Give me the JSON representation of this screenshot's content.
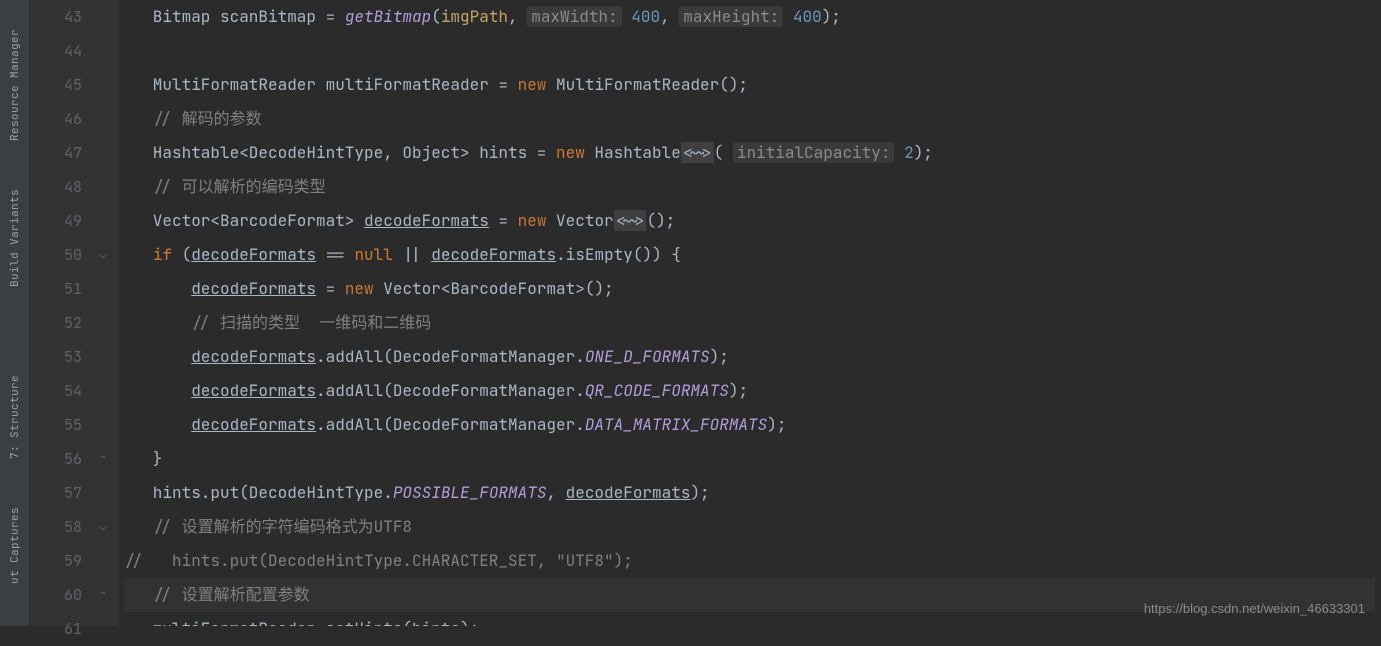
{
  "sidebar": {
    "items": [
      {
        "label": "Resource Manager"
      },
      {
        "label": "Build Variants"
      },
      {
        "label": "7: Structure"
      },
      {
        "label": "ut Captures"
      }
    ]
  },
  "gutter": {
    "start": 43,
    "end": 61
  },
  "code": {
    "lines": [
      {
        "n": 43,
        "segs": [
          {
            "t": "   Bitmap scanBitmap = ",
            "c": "type"
          },
          {
            "t": "getBitmap",
            "c": "meth"
          },
          {
            "t": "(",
            "c": "type"
          },
          {
            "t": "imgPath",
            "c": "param"
          },
          {
            "t": ", ",
            "c": "type"
          },
          {
            "t": "maxWidth:",
            "c": "paramhint"
          },
          {
            "t": " ",
            "c": "type"
          },
          {
            "t": "400",
            "c": "num"
          },
          {
            "t": ", ",
            "c": "type"
          },
          {
            "t": "maxHeight:",
            "c": "paramhint"
          },
          {
            "t": " ",
            "c": "type"
          },
          {
            "t": "400",
            "c": "num"
          },
          {
            "t": ");",
            "c": "type"
          }
        ]
      },
      {
        "n": 44,
        "segs": [
          {
            "t": "",
            "c": "type"
          }
        ]
      },
      {
        "n": 45,
        "segs": [
          {
            "t": "   MultiFormatReader multiFormatReader = ",
            "c": "type"
          },
          {
            "t": "new",
            "c": "kw"
          },
          {
            "t": " MultiFormatReader();",
            "c": "type"
          }
        ]
      },
      {
        "n": 46,
        "segs": [
          {
            "t": "   ",
            "c": "type"
          },
          {
            "t": "// 解码的参数",
            "c": "cmt"
          }
        ]
      },
      {
        "n": 47,
        "segs": [
          {
            "t": "   Hashtable<DecodeHintType, Object> hints = ",
            "c": "type"
          },
          {
            "t": "new",
            "c": "kw"
          },
          {
            "t": " Hashtable",
            "c": "type"
          },
          {
            "t": "<~>",
            "c": "diamondbox"
          },
          {
            "t": "( ",
            "c": "type"
          },
          {
            "t": "initialCapacity:",
            "c": "paramhint"
          },
          {
            "t": " ",
            "c": "type"
          },
          {
            "t": "2",
            "c": "num"
          },
          {
            "t": ");",
            "c": "type"
          }
        ]
      },
      {
        "n": 48,
        "segs": [
          {
            "t": "   ",
            "c": "type"
          },
          {
            "t": "// 可以解析的编码类型",
            "c": "cmt"
          }
        ]
      },
      {
        "n": 49,
        "segs": [
          {
            "t": "   Vector<BarcodeFormat> ",
            "c": "type"
          },
          {
            "t": "decodeFormats",
            "c": "under"
          },
          {
            "t": " = ",
            "c": "type"
          },
          {
            "t": "new",
            "c": "kw"
          },
          {
            "t": " Vector",
            "c": "type"
          },
          {
            "t": "<~>",
            "c": "diamondbox"
          },
          {
            "t": "();",
            "c": "type"
          }
        ]
      },
      {
        "n": 50,
        "segs": [
          {
            "t": "   ",
            "c": "type"
          },
          {
            "t": "if",
            "c": "kw"
          },
          {
            "t": " (",
            "c": "type"
          },
          {
            "t": "decodeFormats",
            "c": "under"
          },
          {
            "t": " == ",
            "c": "type"
          },
          {
            "t": "null",
            "c": "kw"
          },
          {
            "t": " || ",
            "c": "type"
          },
          {
            "t": "decodeFormats",
            "c": "under"
          },
          {
            "t": ".isEmpty()) {",
            "c": "type"
          }
        ]
      },
      {
        "n": 51,
        "segs": [
          {
            "t": "       ",
            "c": "type"
          },
          {
            "t": "decodeFormats",
            "c": "under"
          },
          {
            "t": " = ",
            "c": "type"
          },
          {
            "t": "new",
            "c": "kw"
          },
          {
            "t": " Vector<BarcodeFormat>();",
            "c": "type"
          }
        ]
      },
      {
        "n": 52,
        "segs": [
          {
            "t": "       ",
            "c": "type"
          },
          {
            "t": "// 扫描的类型  一维码和二维码",
            "c": "cmt"
          }
        ]
      },
      {
        "n": 53,
        "segs": [
          {
            "t": "       ",
            "c": "type"
          },
          {
            "t": "decodeFormats",
            "c": "under"
          },
          {
            "t": ".addAll(DecodeFormatManager.",
            "c": "type"
          },
          {
            "t": "ONE_D_FORMATS",
            "c": "field"
          },
          {
            "t": ");",
            "c": "type"
          }
        ]
      },
      {
        "n": 54,
        "segs": [
          {
            "t": "       ",
            "c": "type"
          },
          {
            "t": "decodeFormats",
            "c": "under"
          },
          {
            "t": ".addAll(DecodeFormatManager.",
            "c": "type"
          },
          {
            "t": "QR_CODE_FORMATS",
            "c": "field"
          },
          {
            "t": ");",
            "c": "type"
          }
        ]
      },
      {
        "n": 55,
        "segs": [
          {
            "t": "       ",
            "c": "type"
          },
          {
            "t": "decodeFormats",
            "c": "under"
          },
          {
            "t": ".addAll(DecodeFormatManager.",
            "c": "type"
          },
          {
            "t": "DATA_MATRIX_FORMATS",
            "c": "field"
          },
          {
            "t": ");",
            "c": "type"
          }
        ]
      },
      {
        "n": 56,
        "segs": [
          {
            "t": "   }",
            "c": "type"
          }
        ]
      },
      {
        "n": 57,
        "segs": [
          {
            "t": "   hints.put(DecodeHintType.",
            "c": "type"
          },
          {
            "t": "POSSIBLE_FORMATS",
            "c": "field"
          },
          {
            "t": ", ",
            "c": "type"
          },
          {
            "t": "decodeFormats",
            "c": "under"
          },
          {
            "t": ");",
            "c": "type"
          }
        ]
      },
      {
        "n": 58,
        "segs": [
          {
            "t": "   ",
            "c": "type"
          },
          {
            "t": "// 设置解析的字符编码格式为UTF8",
            "c": "cmt"
          }
        ]
      },
      {
        "n": 59,
        "segs": [
          {
            "t": "",
            "c": "type"
          },
          {
            "t": "//   hints.put(DecodeHintType.CHARACTER_SET, \"UTF8\");",
            "c": "cmt"
          }
        ]
      },
      {
        "n": 60,
        "current": true,
        "segs": [
          {
            "t": "   ",
            "c": "type"
          },
          {
            "t": "// 设置解析配置参数",
            "c": "cmt"
          }
        ]
      },
      {
        "n": 61,
        "segs": [
          {
            "t": "   multiFormatReader.setHints(hints);",
            "c": "type"
          }
        ]
      }
    ]
  },
  "foldMarks": [
    {
      "line": 50,
      "glyph": "⌄"
    },
    {
      "line": 56,
      "glyph": "⌃"
    },
    {
      "line": 58,
      "glyph": "⌄"
    },
    {
      "line": 60,
      "glyph": "⌃"
    }
  ],
  "watermark": "https://blog.csdn.net/weixin_46633301"
}
